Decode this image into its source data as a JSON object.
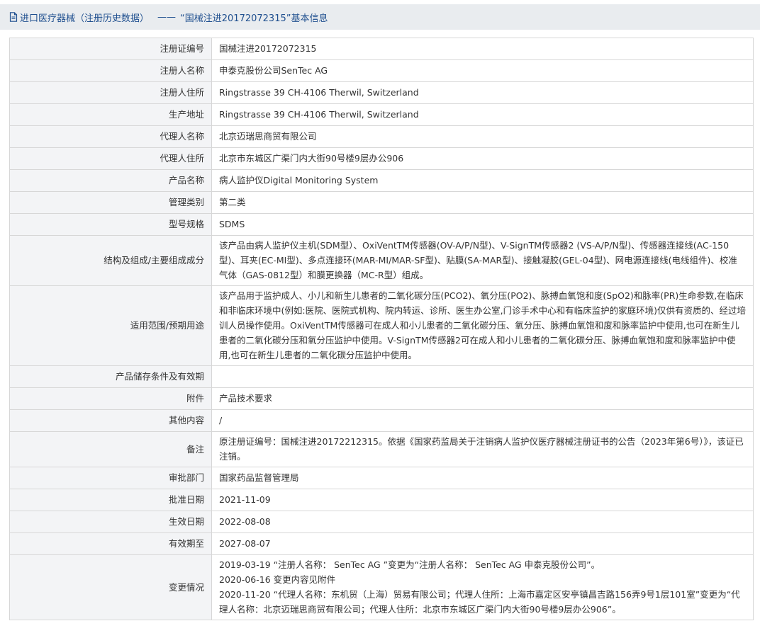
{
  "header": {
    "title": "进口医疗器械（注册历史数据）",
    "separator": "——",
    "subtitle": "“国械注进20172072315”基本信息"
  },
  "rows": [
    {
      "key": "注册证编号",
      "value": "国械注进20172072315"
    },
    {
      "key": "注册人名称",
      "value": "申泰克股份公司SenTec AG"
    },
    {
      "key": "注册人住所",
      "value": "Ringstrasse 39 CH-4106 Therwil, Switzerland"
    },
    {
      "key": "生产地址",
      "value": "Ringstrasse 39 CH-4106 Therwil, Switzerland"
    },
    {
      "key": "代理人名称",
      "value": "北京迈瑞思商贸有限公司"
    },
    {
      "key": "代理人住所",
      "value": "北京市东城区广渠门内大街90号楼9层办公906"
    },
    {
      "key": "产品名称",
      "value": "病人监护仪Digital Monitoring System"
    },
    {
      "key": "管理类别",
      "value": "第二类"
    },
    {
      "key": "型号规格",
      "value": "SDMS"
    },
    {
      "key": "结构及组成/主要组成成分",
      "value": "该产品由病人监护仪主机(SDM型）、OxiVentTM传感器(OV-A/P/N型)、V-SignTM传感器2 (VS-A/P/N型)、传感器连接线(AC-150型)、耳夹(EC-MI型)、多点连接环(MAR-MI/MAR-SF型)、贴膜(SA-MAR型)、接触凝胶(GEL-04型)、网电源连接线(电线组件)、校准气体（GAS-0812型）和膜更换器（MC-R型）组成。"
    },
    {
      "key": "适用范围/预期用途",
      "value": "该产品用于监护成人、小儿和新生儿患者的二氧化碳分压(PCO2)、氧分压(PO2)、脉搏血氧饱和度(SpO2)和脉率(PR)生命参数,在临床和非临床环境中(例如:医院、医院式机构、院内转运、诊所、医生办公室,门诊手术中心和有临床监护的家庭环境)仅供有资质的、经过培训人员操作使用。OxiVentTM传感器可在成人和小儿患者的二氧化碳分压、氧分压、脉搏血氧饱和度和脉率监护中使用,也可在新生儿患者的二氧化碳分压和氧分压监护中使用。V-SignTM传感器2可在成人和小儿患者的二氧化碳分压、脉搏血氧饱和度和脉率监护中使用,也可在新生儿患者的二氧化碳分压监护中使用。"
    },
    {
      "key": "产品储存条件及有效期",
      "value": ""
    },
    {
      "key": "附件",
      "value": "产品技术要求"
    },
    {
      "key": "其他内容",
      "value": "/"
    },
    {
      "key": "备注",
      "value": "原注册证编号：国械注进20172212315。依据《国家药监局关于注销病人监护仪医疗器械注册证书的公告（2023年第6号）》，该证已注销。"
    },
    {
      "key": "审批部门",
      "value": "国家药品监督管理局"
    },
    {
      "key": "批准日期",
      "value": "2021-11-09"
    },
    {
      "key": "生效日期",
      "value": "2022-08-08"
    },
    {
      "key": "有效期至",
      "value": "2027-08-07"
    }
  ],
  "change": {
    "key": "变更情况",
    "lines": [
      "2019-03-19 “注册人名称： SenTec AG ”变更为“注册人名称： SenTec AG 申泰克股份公司”。",
      "2020-06-16 变更内容见附件",
      "2020-11-20 “代理人名称：东机贸（上海）贸易有限公司；代理人住所：上海市嘉定区安亭镇昌吉路156弄9号1层101室”变更为“代理人名称：北京迈瑞思商贸有限公司；代理人住所：北京市东城区广渠门内大街90号楼9层办公906”。"
    ]
  },
  "colors": {
    "header_bg": "#e9ecef",
    "header_text": "#1f4f8f",
    "key_bg": "#f3f4f6",
    "border": "#d7d7d7"
  },
  "icons": {
    "header": "document-icon"
  }
}
